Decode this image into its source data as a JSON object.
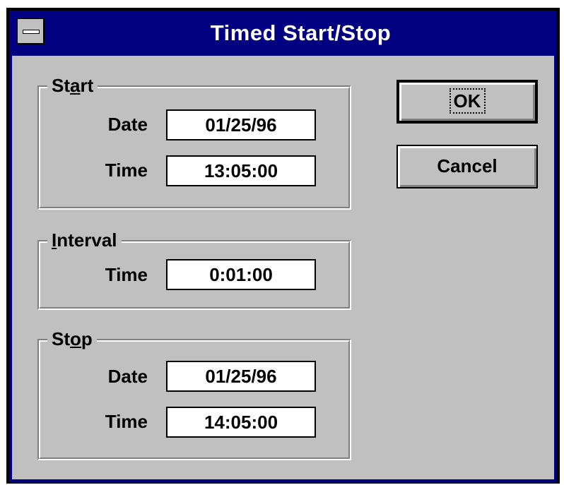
{
  "window": {
    "title": "Timed Start/Stop"
  },
  "start": {
    "legend_pre": "St",
    "legend_accel": "a",
    "legend_post": "rt",
    "date_label": "Date",
    "date_value": "01/25/96",
    "time_label": "Time",
    "time_value": "13:05:00"
  },
  "interval": {
    "legend_pre": "",
    "legend_accel": "I",
    "legend_post": "nterval",
    "time_label": "Time",
    "time_value": "0:01:00"
  },
  "stop": {
    "legend_pre": "St",
    "legend_accel": "o",
    "legend_post": "p",
    "date_label": "Date",
    "date_value": "01/25/96",
    "time_label": "Time",
    "time_value": "14:05:00"
  },
  "buttons": {
    "ok": "OK",
    "cancel": "Cancel"
  },
  "icons": {
    "system_menu": "system-menu-icon"
  },
  "colors": {
    "title_bar": "#000080",
    "face": "#c0c0c0"
  }
}
